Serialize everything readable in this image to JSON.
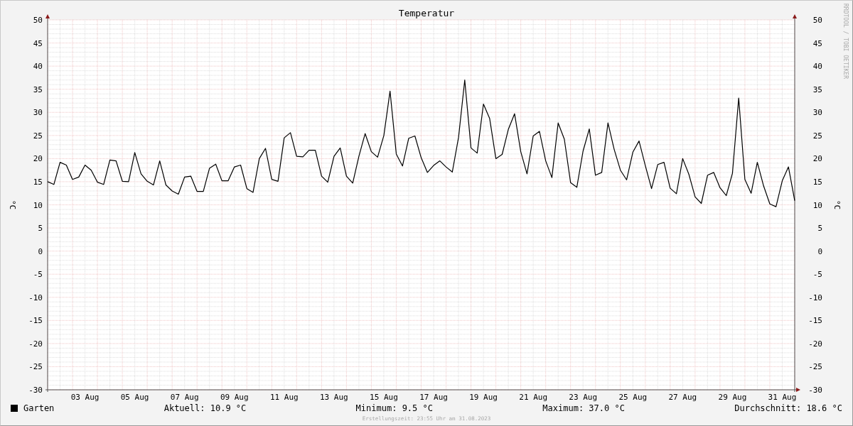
{
  "chart_data": {
    "type": "line",
    "grid": true,
    "title": "Temperatur",
    "ylabel": "°C",
    "ylim": [
      -30,
      50
    ],
    "yticks": [
      50,
      45,
      40,
      35,
      30,
      25,
      20,
      15,
      10,
      5,
      0,
      -5,
      -10,
      -15,
      -20,
      -25,
      -30
    ],
    "categories": [
      null,
      null,
      null,
      null,
      null,
      null,
      "03 Aug",
      null,
      null,
      null,
      null,
      null,
      null,
      null,
      "05 Aug",
      null,
      null,
      null,
      null,
      null,
      null,
      null,
      "07 Aug",
      null,
      null,
      null,
      null,
      null,
      null,
      null,
      "09 Aug",
      null,
      null,
      null,
      null,
      null,
      null,
      null,
      "11 Aug",
      null,
      null,
      null,
      null,
      null,
      null,
      null,
      "13 Aug",
      null,
      null,
      null,
      null,
      null,
      null,
      null,
      "15 Aug",
      null,
      null,
      null,
      null,
      null,
      null,
      null,
      "17 Aug",
      null,
      null,
      null,
      null,
      null,
      null,
      null,
      "19 Aug",
      null,
      null,
      null,
      null,
      null,
      null,
      null,
      "21 Aug",
      null,
      null,
      null,
      null,
      null,
      null,
      null,
      "23 Aug",
      null,
      null,
      null,
      null,
      null,
      null,
      null,
      "25 Aug",
      null,
      null,
      null,
      null,
      null,
      null,
      null,
      "27 Aug",
      null,
      null,
      null,
      null,
      null,
      null,
      null,
      "29 Aug",
      null,
      null,
      null,
      null,
      null,
      null,
      null,
      "31 Aug",
      null,
      null
    ],
    "series": [
      {
        "name": "Garten",
        "color": "#000000",
        "values": [
          15,
          14.4,
          19.2,
          18.6,
          15.5,
          16,
          18.6,
          17.5,
          14.9,
          14.4,
          19.7,
          19.5,
          15.1,
          15,
          21.3,
          16.7,
          15.1,
          14.3,
          19.5,
          14.3,
          13,
          12.3,
          16,
          16.2,
          12.9,
          12.9,
          17.9,
          18.8,
          15.2,
          15.2,
          18.2,
          18.6,
          13.5,
          12.7,
          20,
          22.2,
          15.5,
          15.1,
          24.5,
          25.6,
          20.5,
          20.4,
          21.8,
          21.8,
          16.2,
          14.9,
          20.5,
          22.3,
          16.2,
          14.7,
          20.5,
          25.4,
          21.5,
          20.3,
          25,
          34.6,
          21,
          18.4,
          24.4,
          24.9,
          20.2,
          17,
          18.5,
          19.5,
          18.2,
          17.1,
          24.6,
          37,
          22.3,
          21.2,
          31.8,
          28.7,
          20,
          20.9,
          26.3,
          29.7,
          21.5,
          16.7,
          24.9,
          25.9,
          19.5,
          15.9,
          27.7,
          24.2,
          14.8,
          13.8,
          21.6,
          26.4,
          16.4,
          17,
          27.7,
          22,
          17.5,
          15.4,
          21.4,
          23.8,
          18.5,
          13.5,
          18.7,
          19.2,
          13.6,
          12.4,
          20,
          16.6,
          11.7,
          10.3,
          16.4,
          17,
          13.7,
          12,
          16.8,
          33.1,
          15.5,
          12.5,
          19.2,
          14.1,
          10.2,
          9.6,
          15.2,
          18.2,
          10.9
        ]
      }
    ]
  },
  "right_axis": {
    "ticks": [
      "50",
      "45",
      "40",
      "35",
      "30",
      "25",
      "20",
      "15",
      "10",
      "5",
      "0",
      "-5",
      "-10",
      "-15",
      "-20",
      "-25",
      "-30"
    ],
    "label": "°C"
  },
  "credit": "RRDTOOL / TOBI OETIKER",
  "legend": {
    "stats": [
      "Aktuell: 10.9 °C",
      "Minimum: 9.5 °C",
      "Maximum: 37.0 °C",
      "Durchschnitt: 18.6 °C"
    ]
  },
  "footer": "Erstellungszeit: 23:55 Uhr am 31.08.2023"
}
